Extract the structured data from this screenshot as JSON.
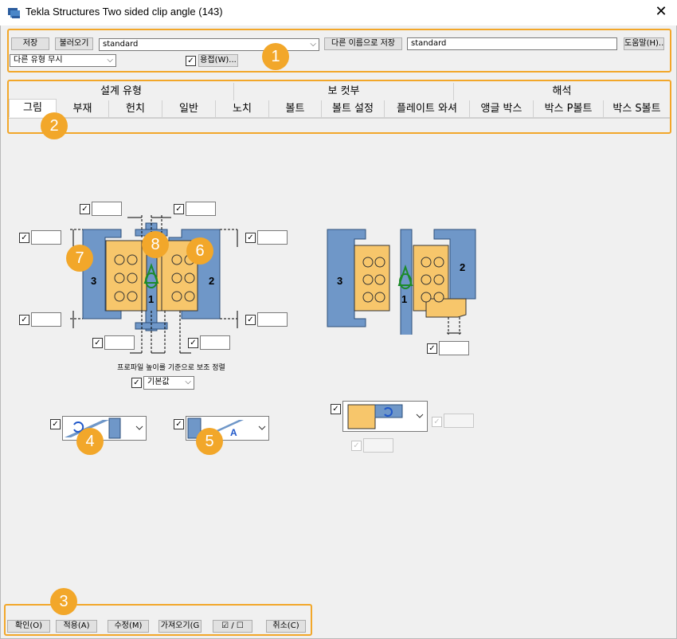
{
  "window": {
    "title": "Tekla Structures  Two sided clip angle (143)"
  },
  "toolbar": {
    "save_label": "저장",
    "load_label": "불러오기",
    "preset_value": "standard",
    "save_as_label": "다른 이름으로 저장",
    "save_as_value": "standard",
    "help_label": "도움말(H)...",
    "ignore_type_value": "다른 유형 무시",
    "weld_label": "용접(W)..."
  },
  "tab_groups": [
    "설계 유형",
    "보 컷부",
    "해석"
  ],
  "tabs": [
    "그림",
    "부재",
    "헌치",
    "일반",
    "노치",
    "볼트",
    "볼트 설정",
    "플레이트 와셔",
    "앵글 박스",
    "박스 P볼트",
    "박스 S볼트"
  ],
  "badges": [
    "1",
    "2",
    "3",
    "4",
    "5",
    "6",
    "7",
    "8"
  ],
  "diagram": {
    "caption": "프로파일 높이를 기준으로 보조 정렬",
    "default_value": "기본값",
    "labels": [
      "3",
      "2",
      "1"
    ]
  },
  "footer": {
    "ok_label": "확인(O)",
    "apply_label": "적용(A)",
    "modify_label": "수정(M)",
    "get_label": "가져오기(G",
    "toggle_label": "☑ / ☐",
    "cancel_label": "취소(C)"
  },
  "colors": {
    "accent": "#f2a72a",
    "beam": "#6f97c8",
    "plate": "#f7c66b"
  }
}
